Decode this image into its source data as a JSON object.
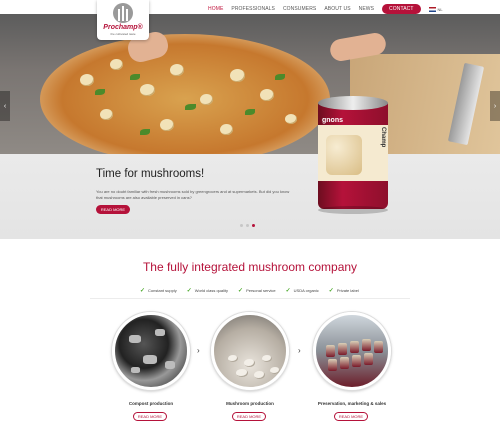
{
  "header": {
    "logo": {
      "brand": "Prochamp®",
      "tagline": "the cultivated taste"
    },
    "nav": [
      {
        "label": "HOME",
        "active": true
      },
      {
        "label": "PROFESSIONALS",
        "active": false
      },
      {
        "label": "CONSUMERS",
        "active": false
      },
      {
        "label": "ABOUT US",
        "active": false
      },
      {
        "label": "NEWS",
        "active": false
      }
    ],
    "contact_label": "CONTACT",
    "language": "NL"
  },
  "hero": {
    "title": "Time for mushrooms!",
    "text": "You are no doubt familiar with fresh mushrooms sold by greengrocers and at supermarkets. But did you know that mushrooms are also available preserved in cans?",
    "button": "READ MORE",
    "can_text": "Champ",
    "can_text_side": "gnons",
    "slides": 3,
    "active_slide": 3
  },
  "section": {
    "title": "The fully integrated mushroom company",
    "features": [
      "Constant supply",
      "World class quality",
      "Personal service",
      "USDA organic",
      "Private label"
    ]
  },
  "steps": [
    {
      "label": "Compost production",
      "button": "READ MORE"
    },
    {
      "label": "Mushroom production",
      "button": "READ MORE"
    },
    {
      "label": "Preservation, marketing & sales",
      "button": "READ MORE"
    }
  ],
  "colors": {
    "brand": "#b5123a",
    "check": "#4aa82a"
  },
  "icons": {
    "prev": "chevron-left-icon",
    "next": "chevron-right-icon",
    "feature": "checkmark-icon",
    "step_separator": "chevron-right-icon"
  }
}
